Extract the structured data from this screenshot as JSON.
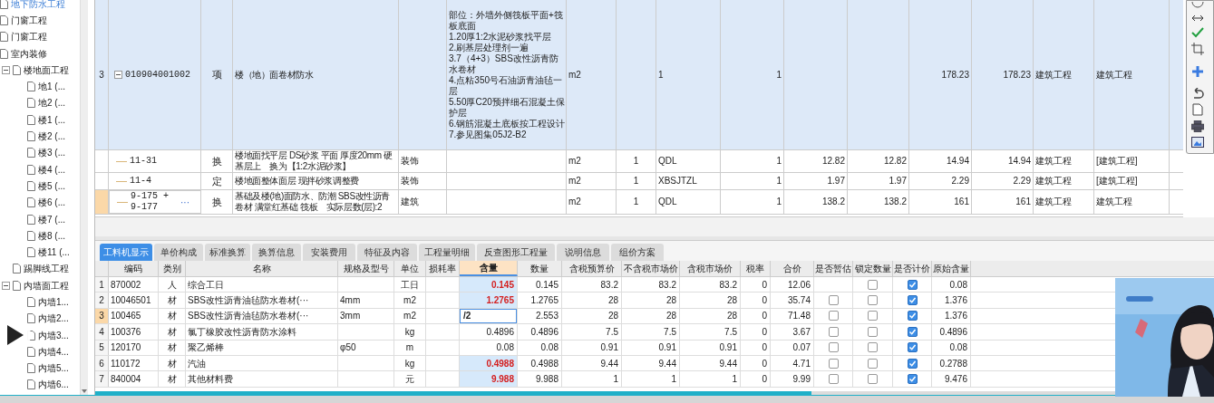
{
  "tree": {
    "items": [
      {
        "label": "地下防水工程",
        "selected": true
      },
      {
        "label": "门窗工程",
        "selected": false
      },
      {
        "label": "门窗工程",
        "selected": false
      },
      {
        "label": "室内装修",
        "selected": false,
        "children": [
          {
            "label": "楼地面工程",
            "selected": false,
            "expanded": true,
            "children": [
              {
                "label": "地1 (...",
                "selected": false
              },
              {
                "label": "地2 (...",
                "selected": false
              },
              {
                "label": "楼1 (...",
                "selected": false
              },
              {
                "label": "楼2 (...",
                "selected": false
              },
              {
                "label": "楼3 (...",
                "selected": false
              },
              {
                "label": "楼4 (...",
                "selected": false
              },
              {
                "label": "楼5 (...",
                "selected": false
              },
              {
                "label": "楼6 (...",
                "selected": false
              },
              {
                "label": "楼7 (...",
                "selected": false
              },
              {
                "label": "楼8 (...",
                "selected": false
              },
              {
                "label": "楼11 (...",
                "selected": false
              }
            ]
          },
          {
            "label": "踢脚线工程",
            "selected": false
          },
          {
            "label": "内墙面工程",
            "selected": false,
            "expanded": true,
            "children": [
              {
                "label": "内墙1...",
                "selected": false
              },
              {
                "label": "内墙2...",
                "selected": false
              },
              {
                "label": "内墙3...",
                "selected": false
              },
              {
                "label": "内墙4...",
                "selected": false
              },
              {
                "label": "内墙5...",
                "selected": false
              },
              {
                "label": "内墙6...",
                "selected": false
              }
            ]
          }
        ]
      }
    ]
  },
  "top_table": {
    "rows": [
      {
        "kind": "item",
        "number": "3",
        "code": "010904001002",
        "expanded": true,
        "type": "项",
        "name": "楼（地）面卷材防水",
        "cells": [
          null,
          "部位：外墙外侧筏板平面+筏板底面\n1.20厚1:2水泥砂浆找平层\n2.刷基层处理剂一遍\n3.7（4+3）SBS改性沥青防水卷材\n4.点粘350号石油沥青油毡一层\n5.50厚C20预拌细石混凝土保护层\n6.钢筋混凝土底板按工程设计\n7.参见图集05J2-B2",
          "m2",
          null,
          "1",
          "1",
          null,
          null,
          "178.23",
          "178.23",
          "建筑工程",
          "建筑工程"
        ],
        "selected": false
      },
      {
        "kind": "sub",
        "code": "11-31",
        "type": "换",
        "name": "楼地面找平层 DS砂浆 平面 厚度20mm 硬基层上　换为【1:2水泥砂浆】",
        "cells": [
          "装饰",
          null,
          "m2",
          "1",
          "QDL",
          "1",
          "12.82",
          "12.82",
          "14.94",
          "14.94",
          "建筑工程",
          "[建筑工程]"
        ],
        "selected": false
      },
      {
        "kind": "sub",
        "code": "11-4",
        "type": "定",
        "name": "楼地面整体面层 现拌砂浆调整费",
        "cells": [
          "装饰",
          null,
          "m2",
          "1",
          "XBSJTZL",
          "1",
          "1.97",
          "1.97",
          "2.29",
          "2.29",
          "建筑工程",
          "[建筑工程]"
        ],
        "selected": false
      },
      {
        "kind": "sub",
        "code": "9-175 + 9-177",
        "more": "···",
        "type": "换",
        "name": "基础及楼(地)面防水、防潮 SBS改性沥青卷材 满堂红基础 筏板　实际层数(层):2",
        "cells": [
          "建筑",
          null,
          "m2",
          "1",
          "QDL",
          "1",
          "138.2",
          "138.2",
          "161",
          "161",
          "建筑工程",
          "建筑工程"
        ],
        "selected": true
      }
    ]
  },
  "tabs": [
    {
      "label": "工料机显示",
      "selected": true
    },
    {
      "label": "单价构成",
      "selected": false
    },
    {
      "label": "标准换算",
      "selected": false
    },
    {
      "label": "换算信息",
      "selected": false
    },
    {
      "label": "安装费用",
      "selected": false
    },
    {
      "label": "特征及内容",
      "selected": false
    },
    {
      "label": "工程量明细",
      "selected": false
    },
    {
      "label": "反查图形工程量",
      "selected": false
    },
    {
      "label": "说明信息",
      "selected": false
    },
    {
      "label": "组价方案",
      "selected": false
    }
  ],
  "resource_table": {
    "columns": [
      {
        "label": "编码",
        "highlighted": false
      },
      {
        "label": "类别",
        "highlighted": false
      },
      {
        "label": "名称",
        "highlighted": false
      },
      {
        "label": "规格及型号",
        "highlighted": false
      },
      {
        "label": "单位",
        "highlighted": false
      },
      {
        "label": "损耗率",
        "highlighted": false
      },
      {
        "label": "含量",
        "highlighted": true
      },
      {
        "label": "数量",
        "highlighted": false
      },
      {
        "label": "含税预算价",
        "highlighted": false
      },
      {
        "label": "不含税市场价",
        "highlighted": false
      },
      {
        "label": "含税市场价",
        "highlighted": false
      },
      {
        "label": "税率",
        "highlighted": false
      },
      {
        "label": "合价",
        "highlighted": false
      },
      {
        "label": "是否暂估",
        "highlighted": false
      },
      {
        "label": "锁定数量",
        "highlighted": false
      },
      {
        "label": "是否计价",
        "highlighted": false
      },
      {
        "label": "原始含量",
        "highlighted": false
      }
    ],
    "rows": [
      {
        "number": "1",
        "code": "870002",
        "category": "人",
        "name": "综合工日",
        "unit": "工日",
        "amount": "0.145",
        "modified": true,
        "editing": false,
        "quantity": "0.145",
        "budget_price": "83.2",
        "market_price_excl_tax": "83.2",
        "market_price": "83.2",
        "tax_rate": "0",
        "total": "12.06",
        "locked": false,
        "priced": true,
        "original_amount": "0.08",
        "selected": false
      },
      {
        "number": "2",
        "code": "10046501",
        "category": "材",
        "name": "SBS改性沥青油毡防水卷材(···",
        "spec": "4mm",
        "unit": "m2",
        "amount": "1.2765",
        "modified": true,
        "editing": false,
        "quantity": "1.2765",
        "budget_price": "28",
        "market_price_excl_tax": "28",
        "market_price": "28",
        "tax_rate": "0",
        "total": "35.74",
        "provisional": false,
        "locked": false,
        "priced": true,
        "original_amount": "1.376",
        "selected": false
      },
      {
        "number": "3",
        "code": "100465",
        "category": "材",
        "name": "SBS改性沥青油毡防水卷材(···",
        "spec": "3mm",
        "unit": "m2",
        "amount": "/2",
        "modified": true,
        "editing": true,
        "quantity": "2.553",
        "budget_price": "28",
        "market_price_excl_tax": "28",
        "market_price": "28",
        "tax_rate": "0",
        "total": "71.48",
        "provisional": false,
        "locked": false,
        "priced": true,
        "original_amount": "1.376",
        "selected": true
      },
      {
        "number": "4",
        "code": "100376",
        "category": "材",
        "name": "氯丁橡胶改性沥青防水涂料",
        "unit": "kg",
        "amount": "0.4896",
        "modified": false,
        "editing": false,
        "quantity": "0.4896",
        "budget_price": "7.5",
        "market_price_excl_tax": "7.5",
        "market_price": "7.5",
        "tax_rate": "0",
        "total": "3.67",
        "provisional": false,
        "locked": false,
        "priced": true,
        "original_amount": "0.4896",
        "selected": false
      },
      {
        "number": "5",
        "code": "120170",
        "category": "材",
        "name": "聚乙烯棒",
        "spec": "φ50",
        "unit": "m",
        "amount": "0.08",
        "modified": false,
        "editing": false,
        "quantity": "0.08",
        "budget_price": "0.91",
        "market_price_excl_tax": "0.91",
        "market_price": "0.91",
        "tax_rate": "0",
        "total": "0.07",
        "provisional": false,
        "locked": false,
        "priced": true,
        "original_amount": "0.08",
        "selected": false
      },
      {
        "number": "6",
        "code": "110172",
        "category": "材",
        "name": "汽油",
        "unit": "kg",
        "amount": "0.4988",
        "modified": true,
        "editing": false,
        "quantity": "0.4988",
        "budget_price": "9.44",
        "market_price_excl_tax": "9.44",
        "market_price": "9.44",
        "tax_rate": "0",
        "total": "4.71",
        "provisional": false,
        "locked": false,
        "priced": true,
        "original_amount": "0.2788",
        "selected": false
      },
      {
        "number": "7",
        "code": "840004",
        "category": "材",
        "name": "其他材料费",
        "unit": "元",
        "amount": "9.988",
        "modified": true,
        "editing": false,
        "quantity": "9.988",
        "budget_price": "1",
        "market_price_excl_tax": "1",
        "market_price": "1",
        "tax_rate": "0",
        "total": "9.99",
        "provisional": false,
        "locked": false,
        "priced": true,
        "original_amount": "9.476",
        "selected": false
      }
    ]
  }
}
